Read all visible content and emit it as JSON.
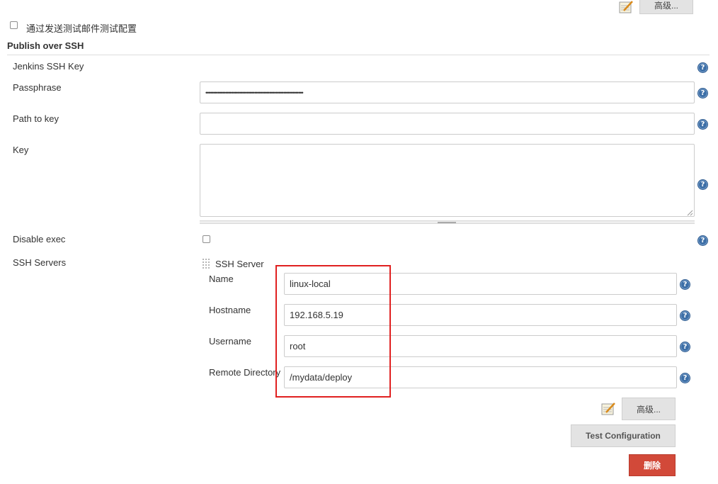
{
  "top": {
    "advanced_label": "高级..."
  },
  "test_mail_checkbox_label": "通过发送测试邮件测试配置",
  "section_title": "Publish over SSH",
  "fields": {
    "jenkins_ssh_key_label": "Jenkins SSH Key",
    "passphrase_label": "Passphrase",
    "passphrase_value": "••••••••••••••••••••••••••••••••••••••••••••••••••••••••••••••••",
    "path_to_key_label": "Path to key",
    "path_to_key_value": "",
    "key_label": "Key",
    "key_value": "",
    "disable_exec_label": "Disable exec",
    "ssh_servers_label": "SSH Servers"
  },
  "ssh_server": {
    "header": "SSH Server",
    "name_label": "Name",
    "name_value": "linux-local",
    "hostname_label": "Hostname",
    "hostname_value": "192.168.5.19",
    "username_label": "Username",
    "username_value": "root",
    "remote_dir_label": "Remote Directory",
    "remote_dir_value": "/mydata/deploy",
    "advanced_label": "高级...",
    "test_config_label": "Test Configuration",
    "delete_label": "删除"
  },
  "help_glyph": "?",
  "colors": {
    "highlight_box": "#e02020",
    "delete_button": "#d24939",
    "help_icon": "#3d6fa7"
  },
  "icons": [
    "notepad-icon",
    "help-icon",
    "drag-handle-icon"
  ]
}
